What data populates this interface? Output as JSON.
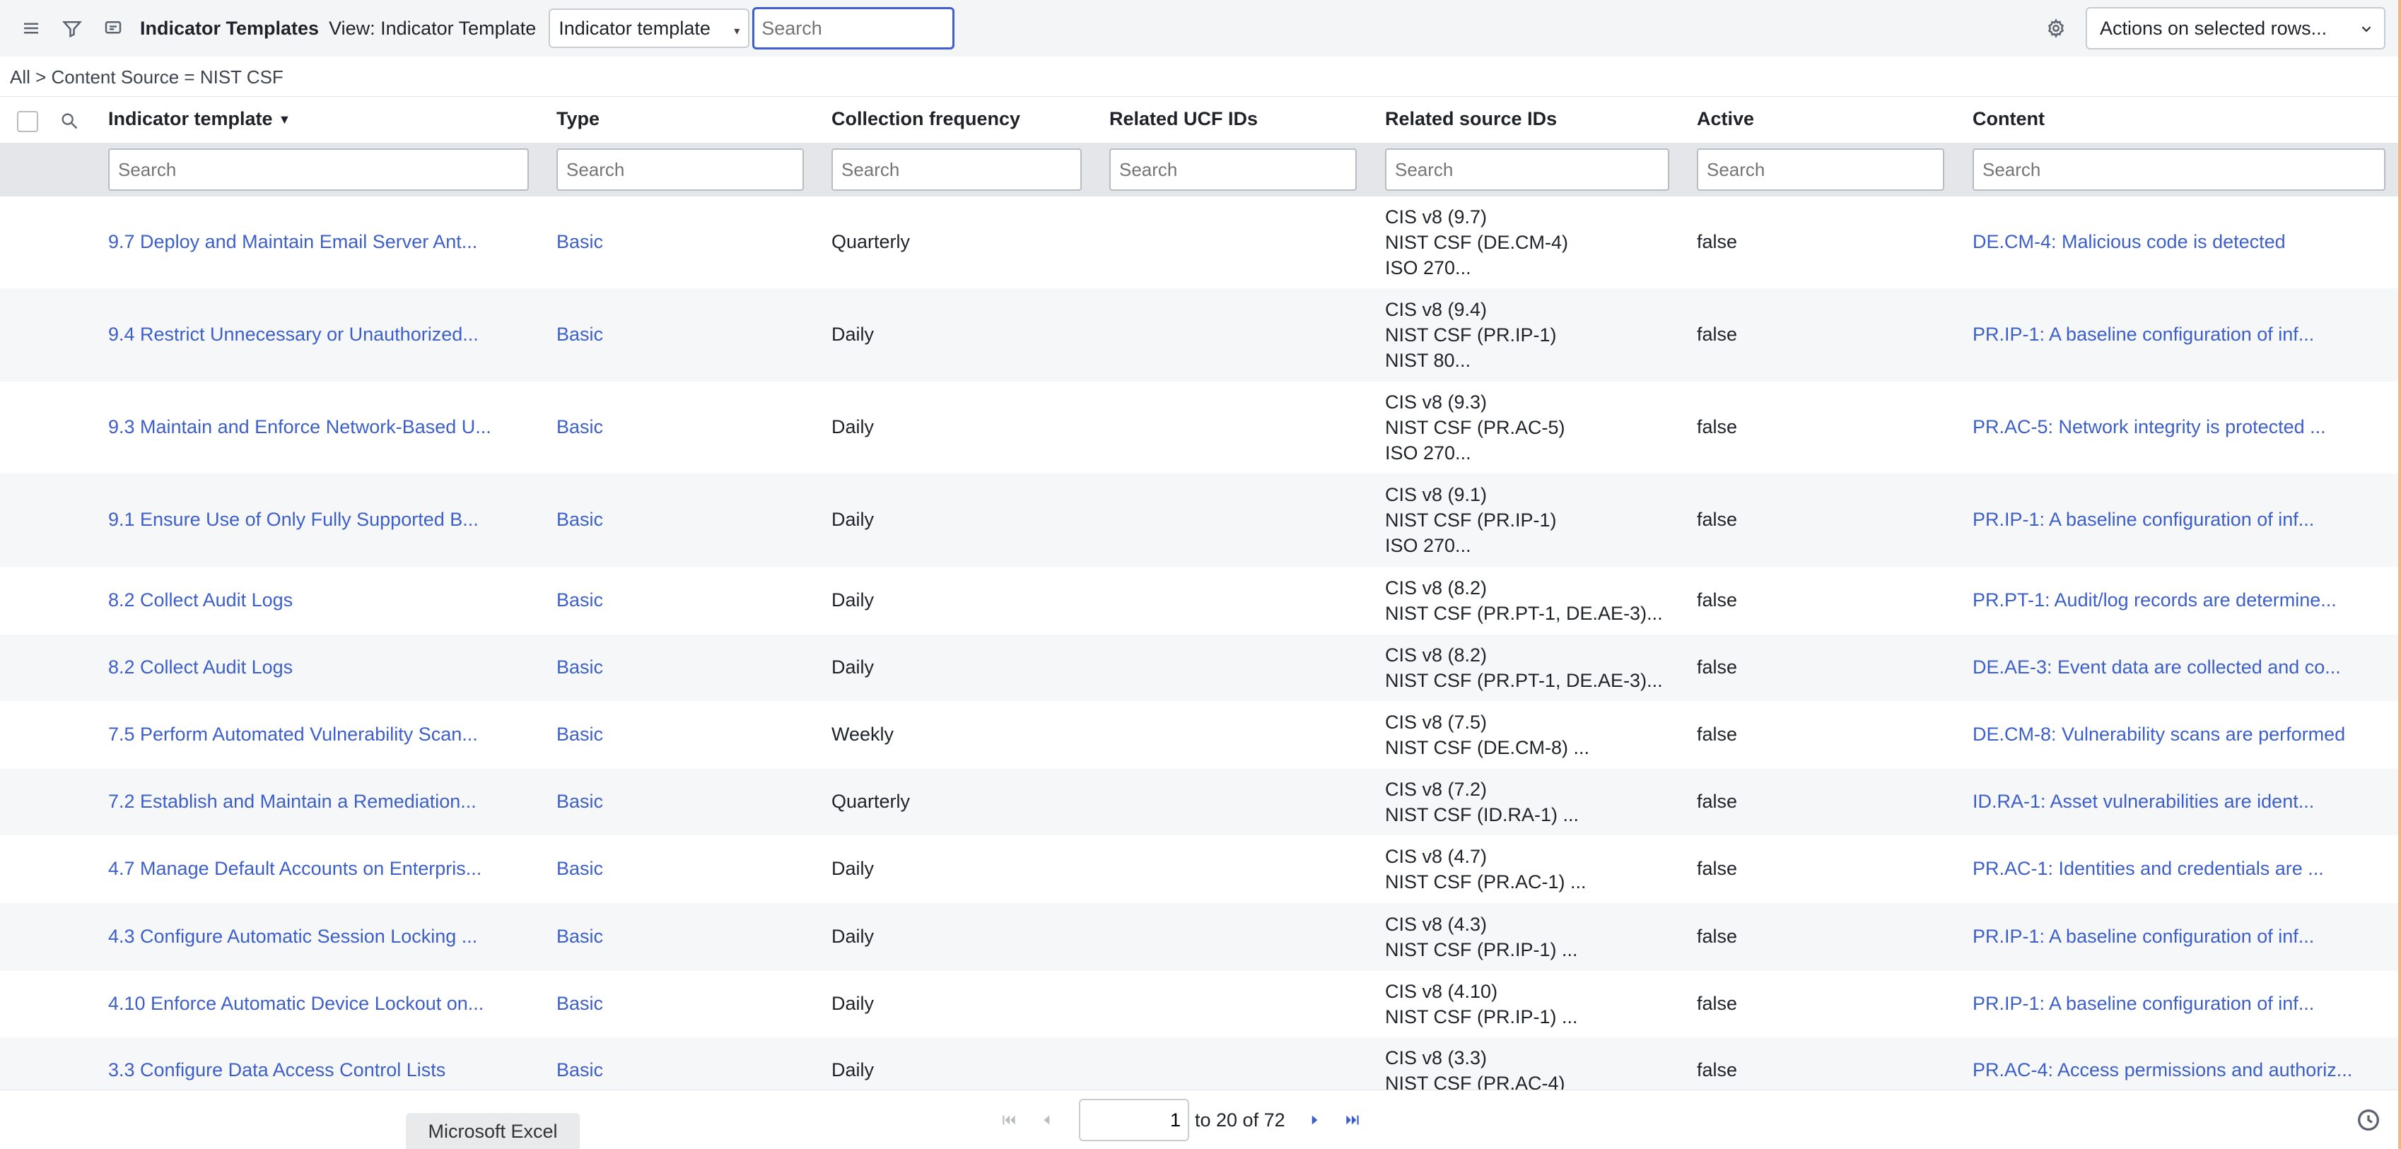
{
  "header": {
    "title": "Indicator Templates",
    "view_label": "View: Indicator Template",
    "field_select": "Indicator template",
    "search_placeholder": "Search",
    "actions_select": "Actions on selected rows..."
  },
  "breadcrumb": "All > Content Source = NIST CSF",
  "columns": {
    "indicator": "Indicator template",
    "type": "Type",
    "frequency": "Collection frequency",
    "ucf": "Related UCF IDs",
    "source": "Related source IDs",
    "active": "Active",
    "content": "Content"
  },
  "column_search_placeholder": "Search",
  "rows": [
    {
      "indicator": "9.7 Deploy and Maintain Email Server Ant...",
      "type": "Basic",
      "frequency": "Quarterly",
      "ucf": "",
      "source": [
        "CIS v8 (9.7)",
        "NIST CSF (DE.CM-4)",
        "ISO 270..."
      ],
      "active": "false",
      "content": "DE.CM-4: Malicious code is detected"
    },
    {
      "indicator": "9.4 Restrict Unnecessary or Unauthorized...",
      "type": "Basic",
      "frequency": "Daily",
      "ucf": "",
      "source": [
        "CIS v8 (9.4)",
        "NIST CSF (PR.IP-1)",
        "NIST 80..."
      ],
      "active": "false",
      "content": "PR.IP-1: A baseline configuration of inf..."
    },
    {
      "indicator": "9.3 Maintain and Enforce Network-Based U...",
      "type": "Basic",
      "frequency": "Daily",
      "ucf": "",
      "source": [
        "CIS v8 (9.3)",
        "NIST CSF (PR.AC-5)",
        "ISO 270..."
      ],
      "active": "false",
      "content": "PR.AC-5: Network integrity is protected ..."
    },
    {
      "indicator": "9.1 Ensure Use of Only Fully Supported B...",
      "type": "Basic",
      "frequency": "Daily",
      "ucf": "",
      "source": [
        "CIS v8 (9.1)",
        "NIST CSF (PR.IP-1)",
        "ISO 270..."
      ],
      "active": "false",
      "content": "PR.IP-1: A baseline configuration of inf..."
    },
    {
      "indicator": "8.2 Collect Audit Logs",
      "type": "Basic",
      "frequency": "Daily",
      "ucf": "",
      "source": [
        "CIS v8 (8.2)",
        "NIST CSF (PR.PT-1, DE.AE-3)..."
      ],
      "active": "false",
      "content": "PR.PT-1: Audit/log records are determine..."
    },
    {
      "indicator": "8.2 Collect Audit Logs",
      "type": "Basic",
      "frequency": "Daily",
      "ucf": "",
      "source": [
        "CIS v8 (8.2)",
        "NIST CSF (PR.PT-1, DE.AE-3)..."
      ],
      "active": "false",
      "content": "DE.AE-3: Event data are collected and co..."
    },
    {
      "indicator": "7.5 Perform Automated Vulnerability Scan...",
      "type": "Basic",
      "frequency": "Weekly",
      "ucf": "",
      "source": [
        "CIS v8 (7.5)",
        "NIST CSF (DE.CM-8) ..."
      ],
      "active": "false",
      "content": "DE.CM-8: Vulnerability scans are performed"
    },
    {
      "indicator": "7.2 Establish and Maintain a Remediation...",
      "type": "Basic",
      "frequency": "Quarterly",
      "ucf": "",
      "source": [
        "CIS v8 (7.2)",
        "NIST CSF (ID.RA-1) ..."
      ],
      "active": "false",
      "content": "ID.RA-1: Asset vulnerabilities are ident..."
    },
    {
      "indicator": "4.7 Manage Default Accounts on Enterpris...",
      "type": "Basic",
      "frequency": "Daily",
      "ucf": "",
      "source": [
        "CIS v8 (4.7)",
        "NIST CSF (PR.AC-1) ..."
      ],
      "active": "false",
      "content": "PR.AC-1: Identities and credentials are ..."
    },
    {
      "indicator": "4.3 Configure Automatic Session Locking ...",
      "type": "Basic",
      "frequency": "Daily",
      "ucf": "",
      "source": [
        "CIS v8 (4.3)",
        "NIST CSF (PR.IP-1) ..."
      ],
      "active": "false",
      "content": "PR.IP-1: A baseline configuration of inf..."
    },
    {
      "indicator": "4.10 Enforce Automatic Device Lockout on...",
      "type": "Basic",
      "frequency": "Daily",
      "ucf": "",
      "source": [
        "CIS v8 (4.10)",
        "NIST CSF (PR.IP-1) ..."
      ],
      "active": "false",
      "content": "PR.IP-1: A baseline configuration of inf..."
    },
    {
      "indicator": "3.3 Configure Data Access Control Lists",
      "type": "Basic",
      "frequency": "Daily",
      "ucf": "",
      "source": [
        "CIS v8 (3.3)",
        "NIST CSF (PR.AC-4)"
      ],
      "active": "false",
      "content": "PR.AC-4: Access permissions and authoriz..."
    }
  ],
  "pagination": {
    "page": "1",
    "range_text": "to 20 of 72"
  },
  "taskbar_tab": "Microsoft Excel",
  "icons": {
    "menu": "hamburger-icon",
    "filter": "filter-icon",
    "context": "context-menu-icon",
    "settings": "gear-icon",
    "column_search": "search-icon",
    "first": "first-page-icon",
    "prev": "previous-page-icon",
    "next": "next-page-icon",
    "last": "last-page-icon",
    "clock": "clock-icon"
  },
  "colors": {
    "link": "#3d5fc8",
    "focus_border": "#3f5fd6",
    "search_row_bg": "#e4e6e9",
    "alt_row_bg": "#f6f7f9"
  }
}
